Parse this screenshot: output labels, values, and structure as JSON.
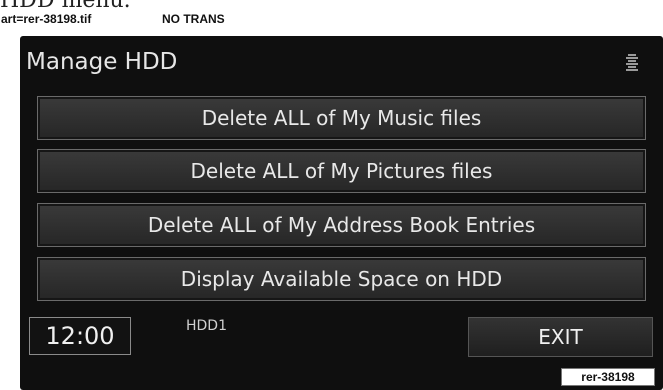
{
  "caption": {
    "partial_text": "HDD menu.",
    "art_ref": "art=rer-38198.tif",
    "trans_note": "NO TRANS"
  },
  "screen": {
    "title": "Manage HDD",
    "menu_items": [
      {
        "label": "Delete ALL of My Music files"
      },
      {
        "label": "Delete ALL of My Pictures files"
      },
      {
        "label": "Delete ALL of My Address Book Entries"
      },
      {
        "label": "Display Available Space on HDD"
      }
    ],
    "clock": "12:00",
    "drive_label": "HDD1",
    "exit_label": "EXIT",
    "icons": {
      "status": "disc-stack-icon"
    }
  },
  "figure_code": "rer-38198",
  "colors": {
    "screen_bg": "#0f0f0f",
    "button_bg": "#2e2e2e",
    "text": "#e8e8e8"
  }
}
